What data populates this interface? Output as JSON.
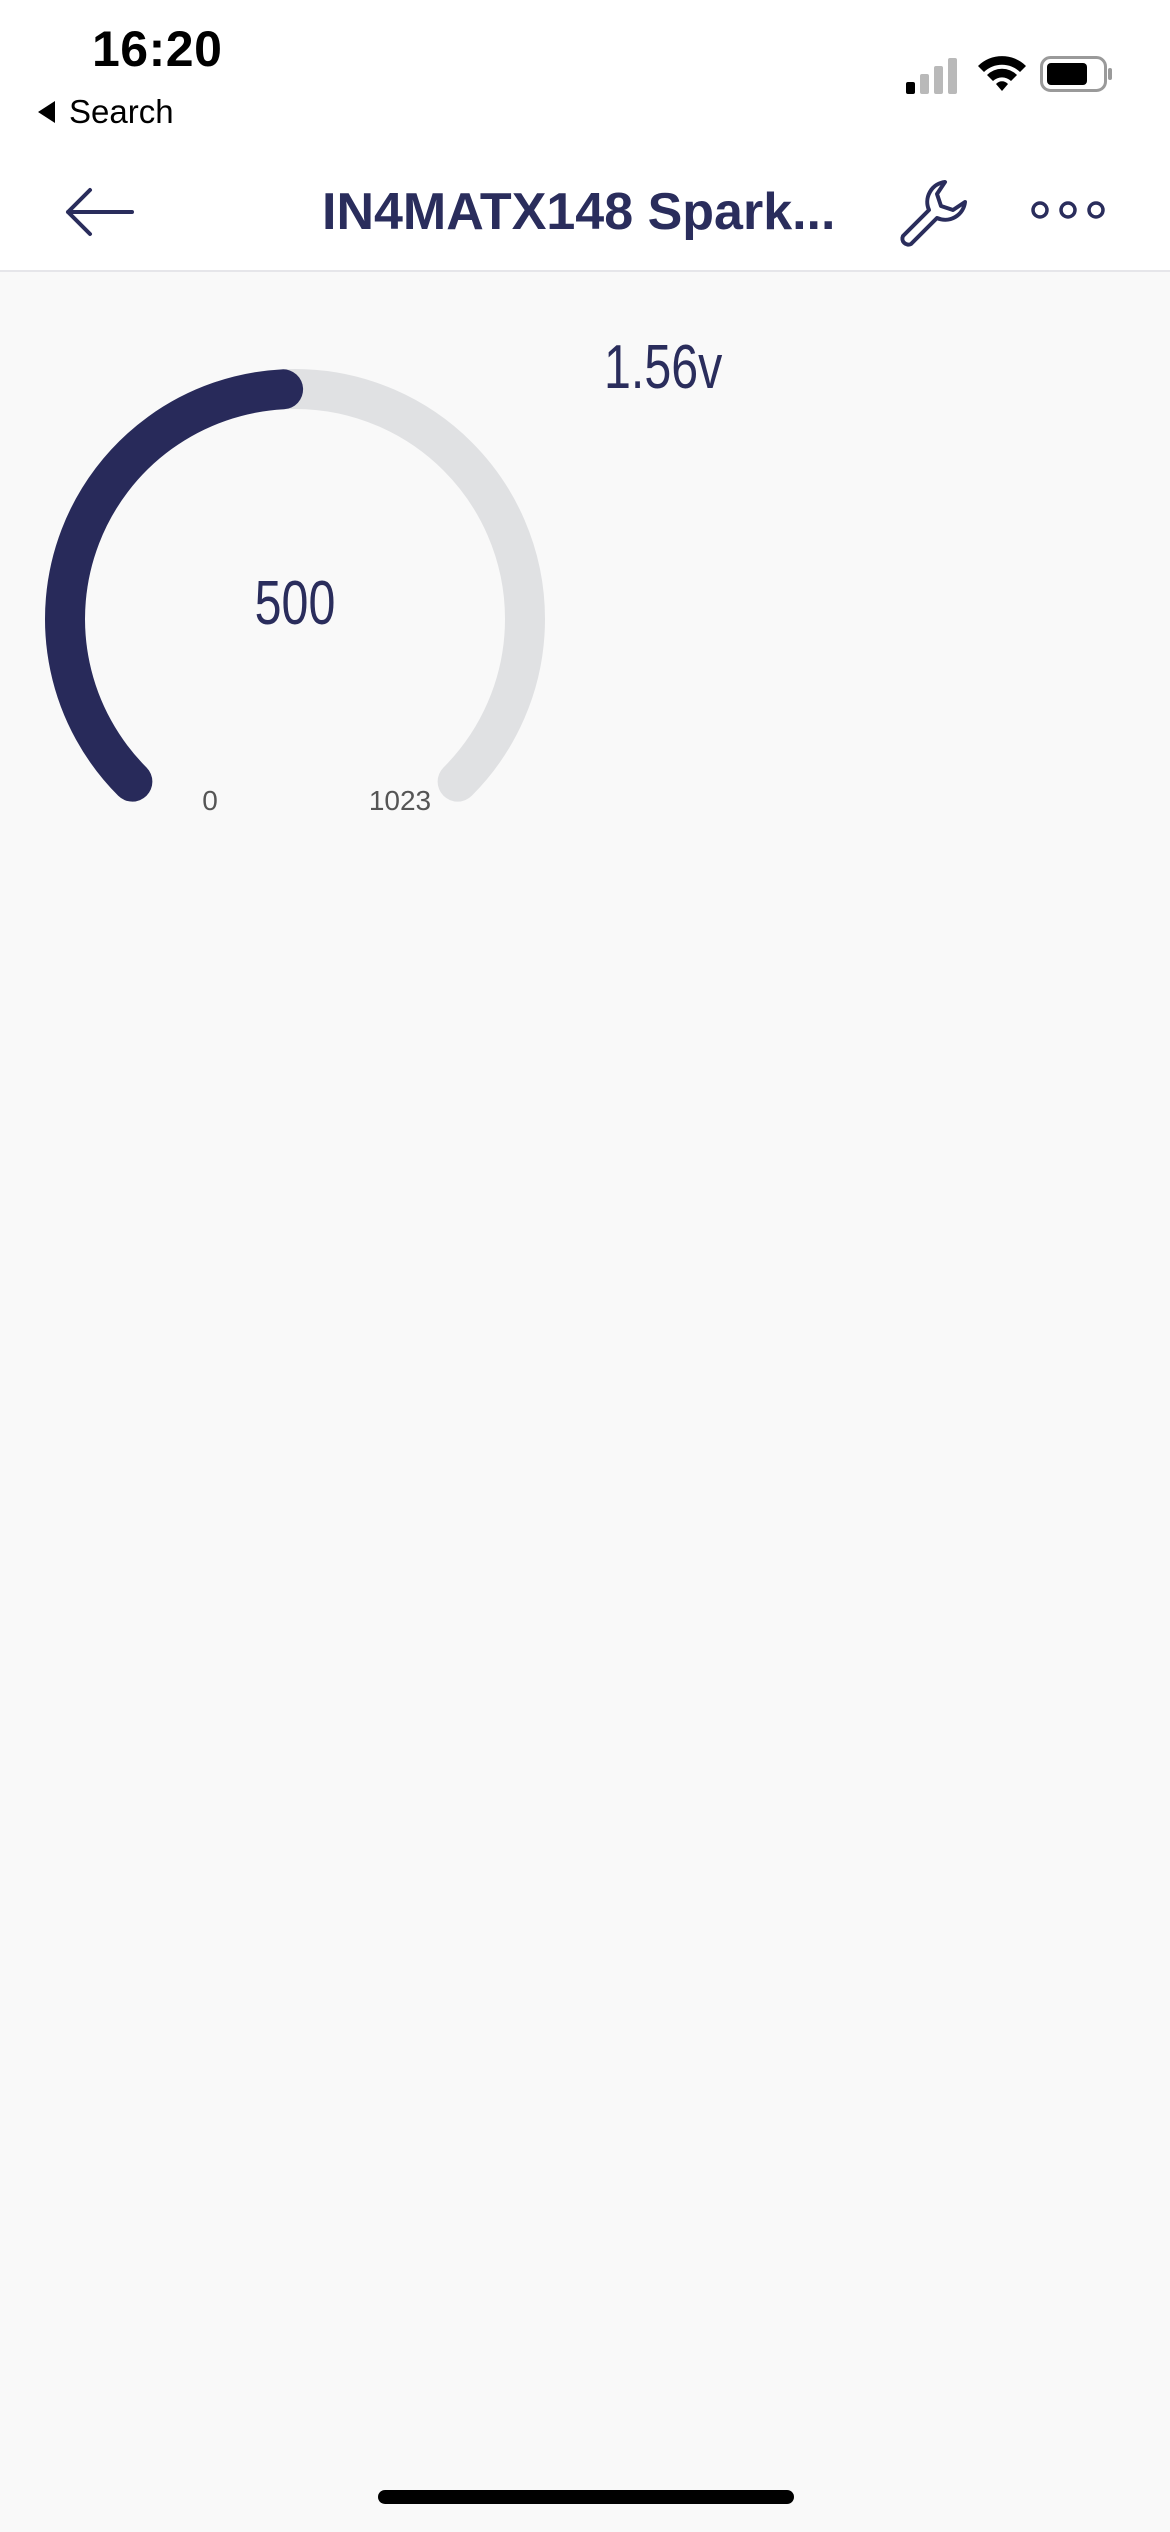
{
  "status_bar": {
    "time": "16:20",
    "back_app_label": "Search",
    "signal_icon": "cellular-signal-icon",
    "wifi_icon": "wifi-icon",
    "battery_icon": "battery-icon"
  },
  "nav_bar": {
    "title": "IN4MATX148 Spark...",
    "back_icon": "arrow-left-icon",
    "settings_icon": "wrench-icon",
    "more_icon": "more-dots-icon"
  },
  "gauge": {
    "value": "500",
    "min": "0",
    "max": "1023",
    "fraction": 0.489,
    "fill_color": "#282a5a",
    "track_color": "#e0e1e3"
  },
  "label_display": {
    "value": "1.56v"
  },
  "colors": {
    "accent": "#2a2d5c",
    "background": "#f9f9f9",
    "header_background": "#ffffff"
  }
}
